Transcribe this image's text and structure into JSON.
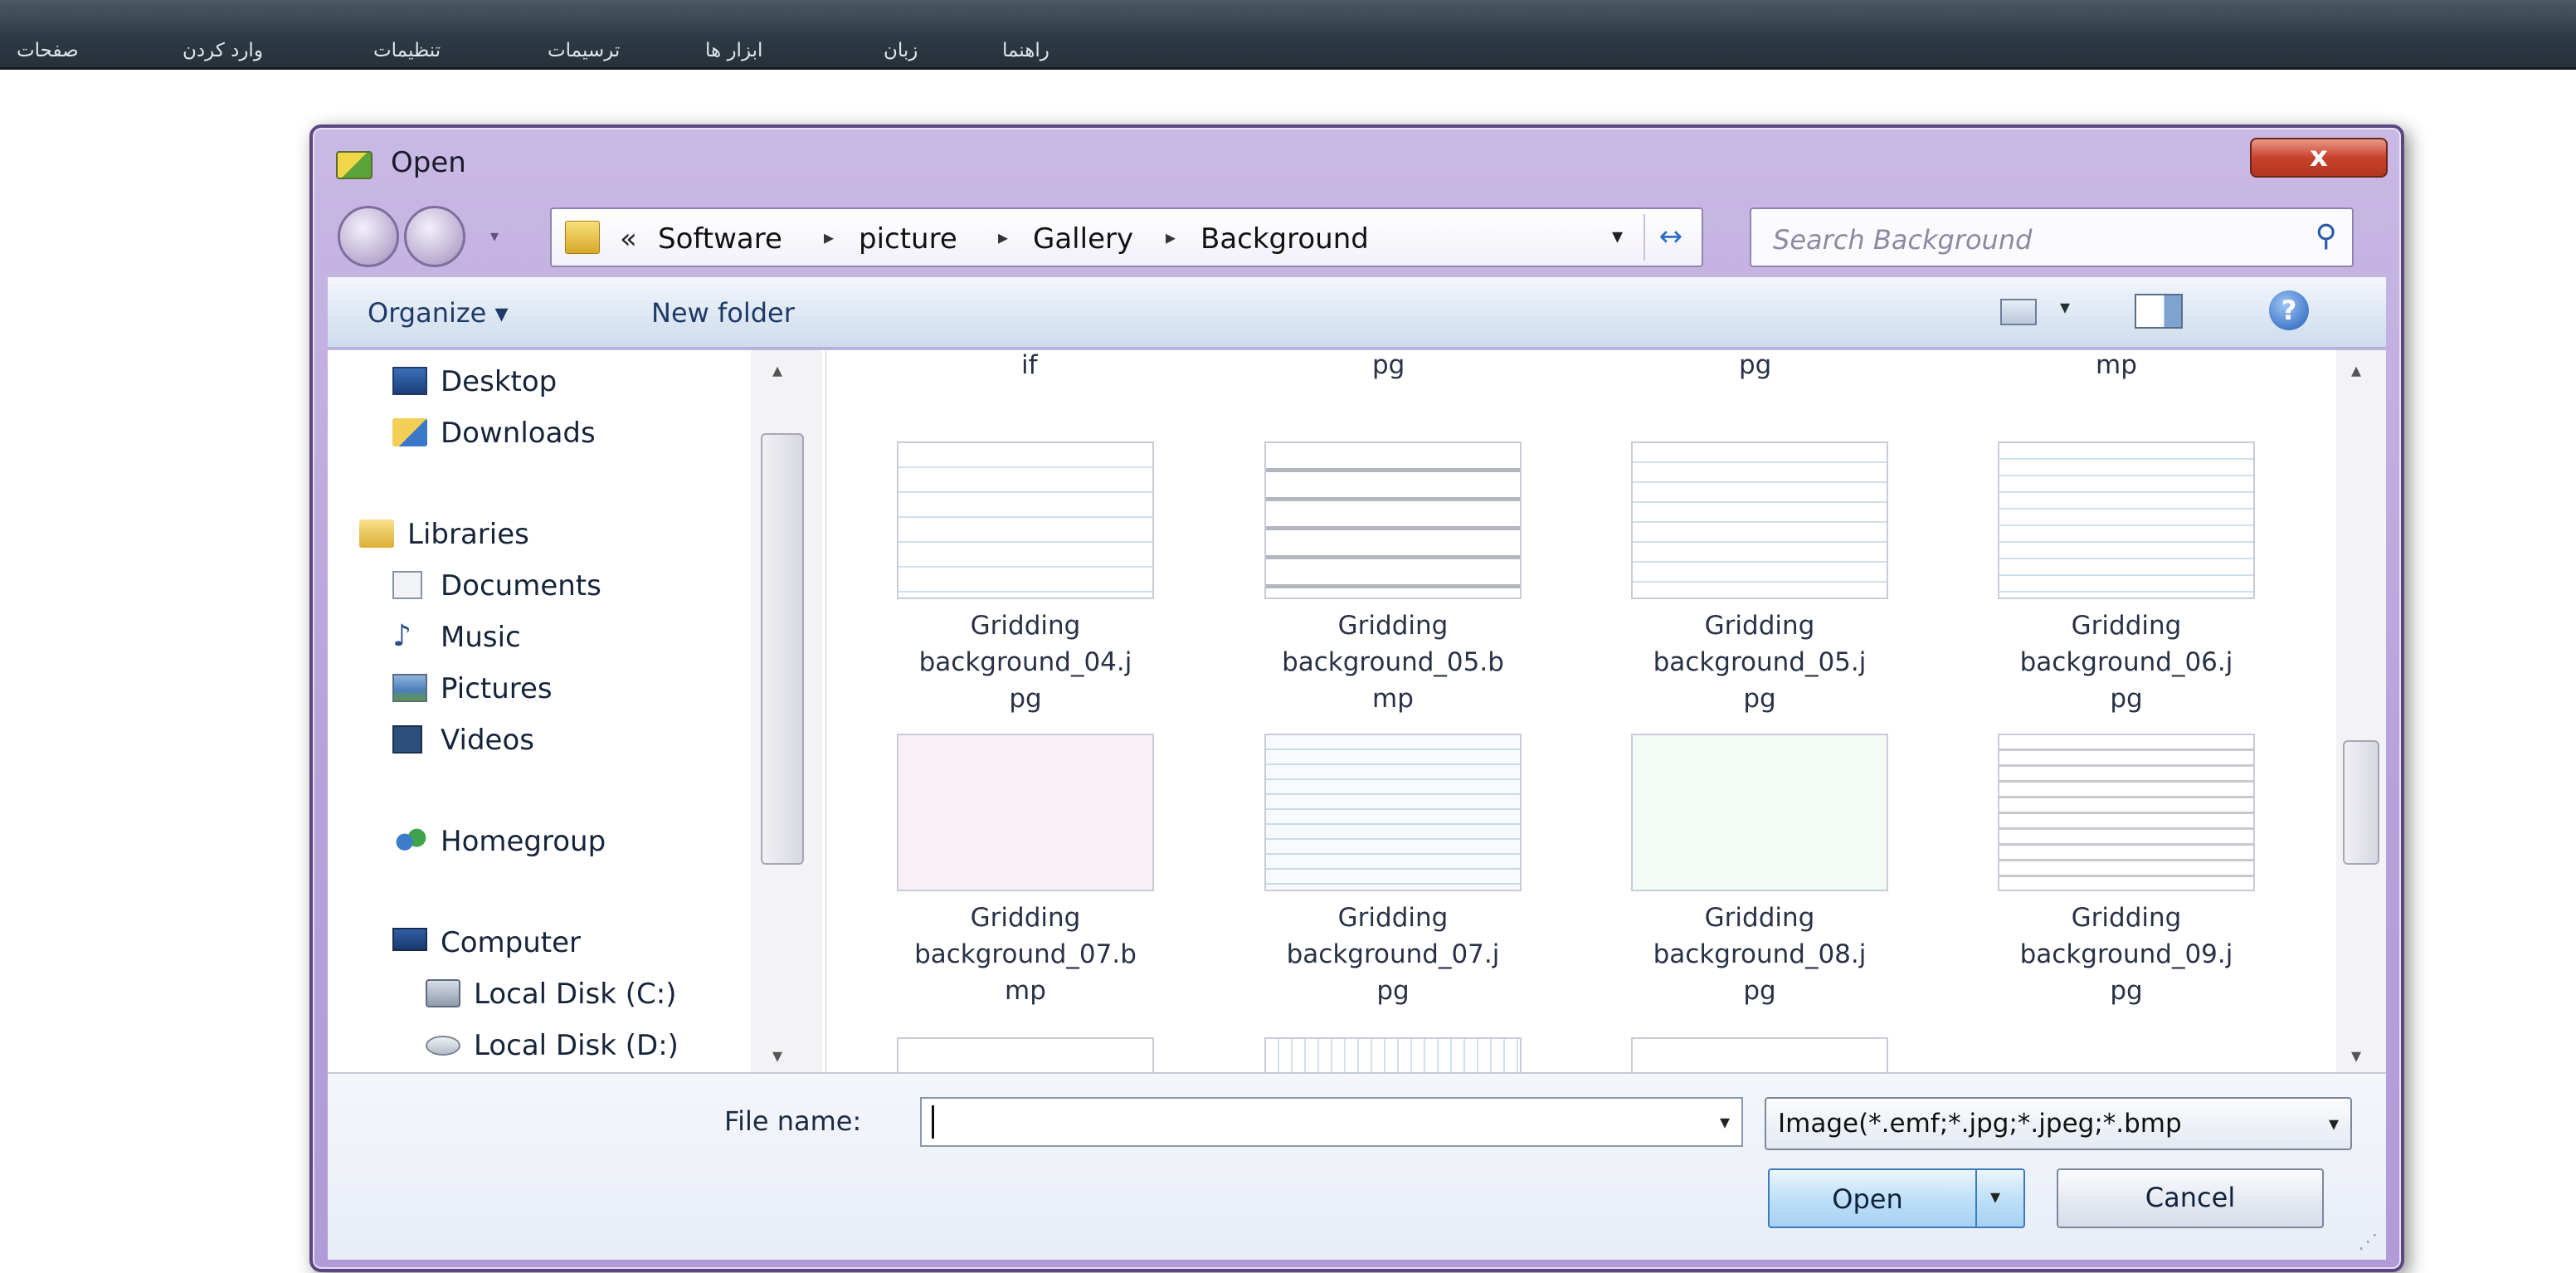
{
  "app_menubar": {
    "items": [
      "صفحات",
      "وارد کردن",
      "تنظیمات",
      "ترسیمات",
      "ابزار ها",
      "زبان",
      "راهنما"
    ]
  },
  "dialog": {
    "title": "Open",
    "close_glyph": "x",
    "address_bar": {
      "overflow_chevron": "«",
      "breadcrumb": [
        "Software",
        "picture",
        "Gallery",
        "Background"
      ],
      "separator": "▸",
      "dropdown_glyph": "▾",
      "refresh_glyph": "↔"
    },
    "search": {
      "placeholder": "Search Background",
      "icon": "search-icon"
    },
    "toolbar": {
      "organize_label": "Organize ▾",
      "new_folder_label": "New folder",
      "views_arrow": "▾",
      "help_glyph": "?"
    },
    "nav_pane": {
      "items": [
        {
          "label": "Desktop",
          "icon": "desktop-icon"
        },
        {
          "label": "Downloads",
          "icon": "downloads-icon"
        },
        {
          "label": "Libraries",
          "icon": "libraries-icon"
        },
        {
          "label": "Documents",
          "icon": "documents-icon"
        },
        {
          "label": "Music",
          "icon": "music-icon"
        },
        {
          "label": "Pictures",
          "icon": "pictures-icon"
        },
        {
          "label": "Videos",
          "icon": "videos-icon"
        },
        {
          "label": "Homegroup",
          "icon": "homegroup-icon"
        },
        {
          "label": "Computer",
          "icon": "computer-icon"
        },
        {
          "label": "Local Disk (C:)",
          "icon": "hard-disk-icon",
          "selected": true
        },
        {
          "label": "Local Disk (D:)",
          "icon": "drive-icon"
        }
      ]
    },
    "files": {
      "top_partial_labels": [
        "if",
        "pg",
        "pg",
        "mp"
      ],
      "rows": [
        [
          {
            "name": "Gridding background_04.jpg",
            "label_lines": [
              "Gridding",
              "background_04.j",
              "pg"
            ]
          },
          {
            "name": "Gridding background_05.bmp",
            "label_lines": [
              "Gridding",
              "background_05.b",
              "mp"
            ]
          },
          {
            "name": "Gridding background_05.jpg",
            "label_lines": [
              "Gridding",
              "background_05.j",
              "pg"
            ]
          },
          {
            "name": "Gridding background_06.jpg",
            "label_lines": [
              "Gridding",
              "background_06.j",
              "pg"
            ]
          }
        ],
        [
          {
            "name": "Gridding background_07.bmp",
            "label_lines": [
              "Gridding",
              "background_07.b",
              "mp"
            ]
          },
          {
            "name": "Gridding background_07.jpg",
            "label_lines": [
              "Gridding",
              "background_07.j",
              "pg"
            ]
          },
          {
            "name": "Gridding background_08.jpg",
            "label_lines": [
              "Gridding",
              "background_08.j",
              "pg"
            ]
          },
          {
            "name": "Gridding background_09.jpg",
            "label_lines": [
              "Gridding",
              "background_09.j",
              "pg"
            ]
          }
        ]
      ]
    },
    "bottom": {
      "file_name_label": "File name:",
      "file_name_value": "",
      "file_type_value": "Image(*.emf;*.jpg;*.jpeg;*.bmp",
      "open_label": "Open",
      "cancel_label": "Cancel",
      "dropdown_glyph": "▾"
    }
  }
}
